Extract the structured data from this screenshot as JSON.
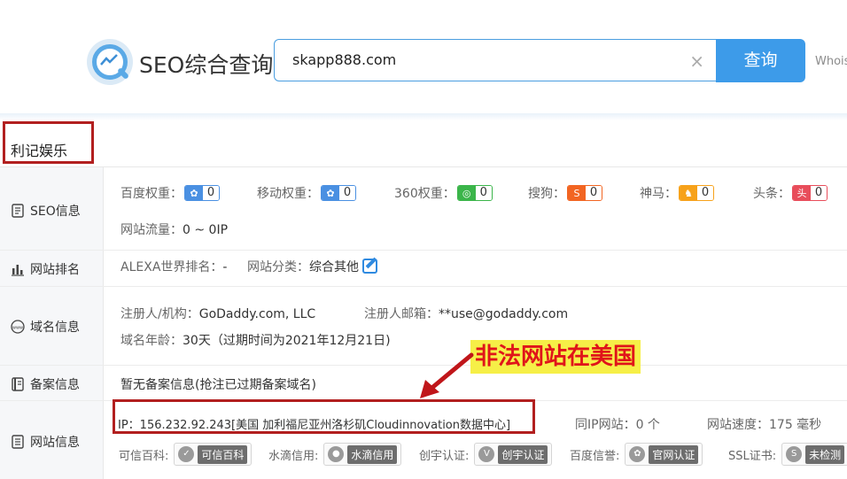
{
  "header": {
    "logo_title": "SEO综合查询",
    "search_value": "skapp888.com",
    "clear_symbol": "×",
    "search_button": "查询",
    "whois_link": "Whois"
  },
  "site": {
    "name": "利记娱乐"
  },
  "rows": {
    "seo": {
      "label": "SEO信息",
      "items": [
        {
          "label": "百度权重：",
          "value": "0",
          "color": "#4a90e2"
        },
        {
          "label": "移动权重：",
          "value": "0",
          "color": "#4a90e2"
        },
        {
          "label": "360权重：",
          "value": "0",
          "color": "#3bb54a"
        },
        {
          "label": "搜狗：",
          "value": "0",
          "color": "#f26522"
        },
        {
          "label": "神马：",
          "value": "0",
          "color": "#f7a21a"
        },
        {
          "label": "头条：",
          "value": "0",
          "color": "#e84d5b"
        }
      ],
      "traffic_label": "网站流量：",
      "traffic_value": "0 ~ 0IP"
    },
    "rank": {
      "label": "网站排名",
      "alexa_label": "ALEXA世界排名：",
      "alexa_value": "-",
      "category_label": "网站分类：",
      "category_value": "综合其他"
    },
    "domain": {
      "label": "域名信息",
      "registrar_label": "注册人/机构：",
      "registrar_value": "GoDaddy.com, LLC",
      "email_label": "注册人邮箱：",
      "email_value": "**use@godaddy.com",
      "age_label": "域名年龄：",
      "age_value": "30天（过期时间为2021年12月21日)"
    },
    "icp": {
      "label": "备案信息",
      "text": "暂无备案信息(抢注已过期备案域名)"
    },
    "website": {
      "label": "网站信息",
      "ip_text": "IP：156.232.92.243[美国 加利福尼亚州洛杉矶Cloudinnovation数据中心]",
      "same_ip": "同IP网站：0 个",
      "speed": "网站速度：175 毫秒"
    }
  },
  "annotation": {
    "text": "非法网站在美国",
    "color": "#e0141a",
    "bg": "#f6ef47"
  },
  "certs": [
    {
      "label": "可信百科:",
      "badge": "可信百科"
    },
    {
      "label": "水滴信用:",
      "badge": "水滴信用"
    },
    {
      "label": "创宇认证:",
      "badge": "创宇认证"
    },
    {
      "label": "百度信誉:",
      "badge": "官网认证"
    },
    {
      "label": "SSL证书:",
      "badge": "未检测"
    }
  ]
}
